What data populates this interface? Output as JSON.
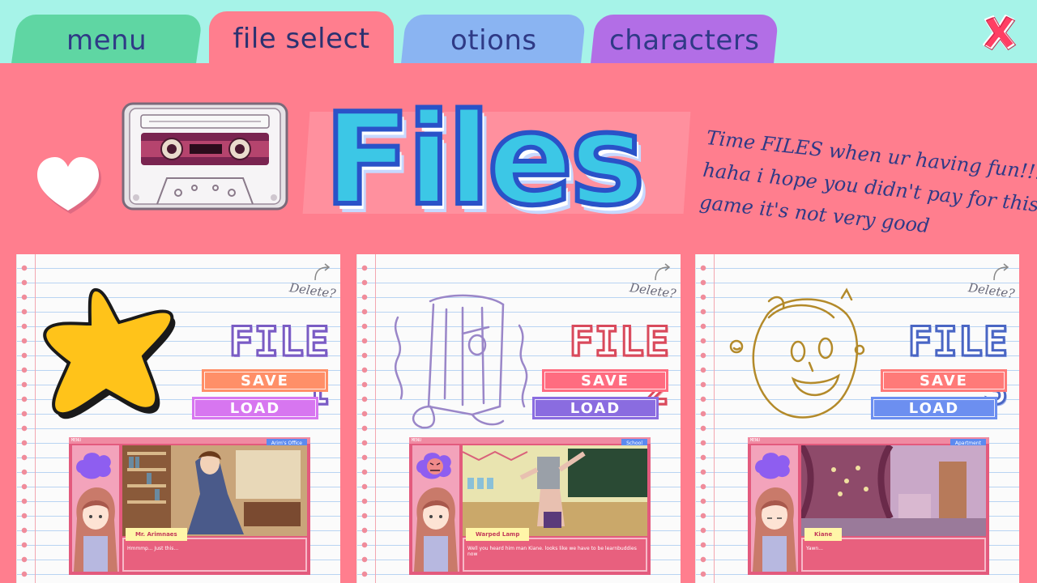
{
  "tabs": {
    "menu": "menu",
    "file_select": "file select",
    "options": "otions",
    "characters": "characters"
  },
  "close_icon": "x-close-icon",
  "title": "Files",
  "tagline": [
    "Time FILES when ur having fun!!!1",
    "haha i hope you didn't pay for this",
    "game it's not very good"
  ],
  "files": [
    {
      "label": "FILE 1",
      "delete": "Delete?",
      "save": "SAVE",
      "load": "LOAD",
      "doodle": "yellow-star-icon",
      "preview": {
        "menu": "MENU",
        "location": "Arim's Office",
        "name": "Mr. Arimnaes",
        "text": "Hmmmp... Just this..."
      }
    },
    {
      "label": "FILE 2",
      "delete": "Delete?",
      "save": "SAVE",
      "load": "LOAD",
      "doodle": "warped-lamp-sketch",
      "preview": {
        "menu": "MENU",
        "location": "School",
        "name": "Warped Lamp",
        "text": "Well you heard him man Kiane. looks like we have to be learnbuddies now"
      }
    },
    {
      "label": "FILE 3",
      "delete": "Delete?",
      "save": "SAVE",
      "load": "LOAD",
      "doodle": "kiane-face-sketch",
      "preview": {
        "menu": "MENU",
        "location": "Apartment",
        "name": "Kiane",
        "text": "Yawn..."
      }
    }
  ],
  "colors": {
    "background_top": "#a6f3e8",
    "panel": "#ff7e8e",
    "tab_menu": "#5fd6a3",
    "tab_options": "#8ab4f2",
    "tab_characters": "#b26ee6",
    "title_fill": "#3cc7e6",
    "title_outline": "#2a52c8"
  }
}
